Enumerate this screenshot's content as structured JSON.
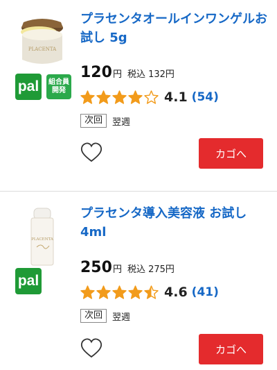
{
  "products": [
    {
      "title": "プラセンタオールインワンゲルお試し 5g",
      "price": "120",
      "yen": "円",
      "tax_label": "税込 132円",
      "pal_badge": "pal",
      "member_badge": [
        "組合員",
        "開発"
      ],
      "rating": "4.1",
      "rating_value": 4.1,
      "review_count": "(54)",
      "next_label": "次回",
      "delivery": "翌週",
      "cart_label": "カゴへ",
      "jar_label": "PLACENTA"
    },
    {
      "title": "プラセンタ導入美容液 お試し 4ml",
      "price": "250",
      "yen": "円",
      "tax_label": "税込 275円",
      "pal_badge": "pal",
      "rating": "4.6",
      "rating_value": 4.6,
      "review_count": "(41)",
      "next_label": "次回",
      "delivery": "翌週",
      "cart_label": "カゴへ",
      "bottle_label": "PLACENTA"
    }
  ],
  "colors": {
    "link": "#1668c6",
    "star": "#f29b1b",
    "cart_button": "#e42b2d",
    "pal_green": "#1f9a36"
  }
}
